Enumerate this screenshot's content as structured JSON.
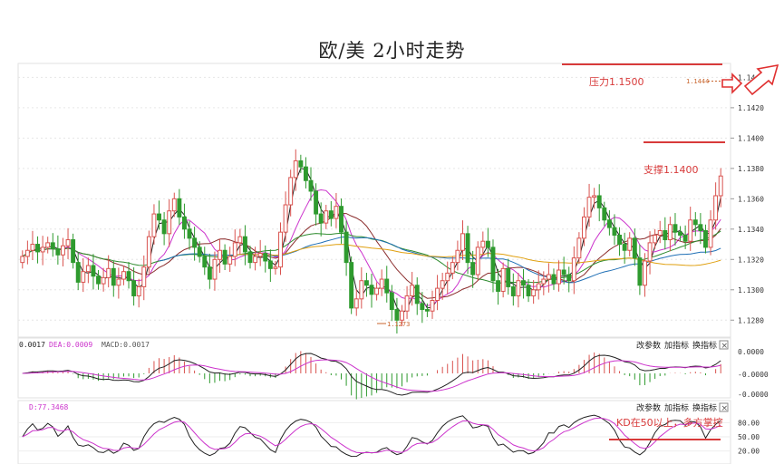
{
  "title": "欧/美 2小时走势",
  "annotations": {
    "resistance": "压力1.1500",
    "support": "支撑1.1400",
    "last_price": "1.1444",
    "low_marker": "1.1273",
    "kd_note": "KD在50以上，多方掌控"
  },
  "macd_legend": {
    "dif": "0.0017",
    "dea": "DEA:0.0009",
    "macd": "MACD:0.0017"
  },
  "kd_legend": {
    "d": "D:77.3468"
  },
  "buttons": {
    "params": "改参数",
    "add": "加指标",
    "swap": "换指标",
    "close": "×"
  },
  "colors": {
    "up": "#d9534f",
    "down": "#2e9a2e",
    "accent": "#d83a3a",
    "black": "#222222",
    "magenta": "#cc33cc"
  },
  "chart_data": [
    {
      "type": "candlestick",
      "title": "欧/美 2小时走势",
      "ylim": [
        1.127,
        1.1448
      ],
      "y_ticks": [
        "1.1280",
        "1.1300",
        "1.1320",
        "1.1340",
        "1.1360",
        "1.1380",
        "1.1400",
        "1.1420",
        "1.1440"
      ],
      "reference_lines": [
        {
          "label": "压力1.1500",
          "value": 1.1444
        },
        {
          "label": "支撑1.1400",
          "value": 1.1399
        }
      ],
      "closes": [
        1.1322,
        1.1326,
        1.133,
        1.1325,
        1.1328,
        1.1331,
        1.1327,
        1.1323,
        1.1329,
        1.1333,
        1.1318,
        1.1305,
        1.1312,
        1.1316,
        1.1309,
        1.1304,
        1.1308,
        1.1314,
        1.1303,
        1.1307,
        1.1312,
        1.1306,
        1.1296,
        1.1302,
        1.1315,
        1.1335,
        1.135,
        1.1346,
        1.1337,
        1.1352,
        1.136,
        1.1348,
        1.134,
        1.1334,
        1.1328,
        1.1322,
        1.1315,
        1.1307,
        1.132,
        1.1326,
        1.1317,
        1.1322,
        1.1331,
        1.1335,
        1.1325,
        1.1318,
        1.1322,
        1.1324,
        1.1319,
        1.1314,
        1.1315,
        1.1338,
        1.1356,
        1.1374,
        1.1385,
        1.1381,
        1.1372,
        1.1365,
        1.135,
        1.1344,
        1.1352,
        1.1347,
        1.1355,
        1.1338,
        1.1318,
        1.1288,
        1.1294,
        1.1306,
        1.1303,
        1.1297,
        1.1301,
        1.1307,
        1.1298,
        1.1287,
        1.128,
        1.1286,
        1.1296,
        1.1303,
        1.1291,
        1.1287,
        1.1286,
        1.1293,
        1.1301,
        1.1306,
        1.1311,
        1.1318,
        1.1326,
        1.1337,
        1.1318,
        1.131,
        1.1328,
        1.1332,
        1.1328,
        1.1306,
        1.1299,
        1.1314,
        1.1302,
        1.1296,
        1.1306,
        1.1303,
        1.1296,
        1.13,
        1.1304,
        1.1307,
        1.131,
        1.1304,
        1.1313,
        1.131,
        1.1306,
        1.1321,
        1.1334,
        1.1348,
        1.1361,
        1.1362,
        1.1354,
        1.1346,
        1.1341,
        1.1336,
        1.133,
        1.1326,
        1.1334,
        1.1321,
        1.1303,
        1.1319,
        1.1331,
        1.1336,
        1.1339,
        1.1333,
        1.1343,
        1.1338,
        1.1336,
        1.1332,
        1.1346,
        1.1343,
        1.1339,
        1.1328,
        1.1346,
        1.1362,
        1.1375
      ],
      "indicators": [
        "MA",
        "MACD",
        "KD"
      ]
    },
    {
      "type": "bar+line",
      "name": "MACD",
      "yticks": [
        "0.0000",
        "-0.0000",
        "-0.0000"
      ]
    },
    {
      "type": "line",
      "name": "KD",
      "yticks": [
        "80.00",
        "50.00",
        "20.00"
      ]
    }
  ]
}
